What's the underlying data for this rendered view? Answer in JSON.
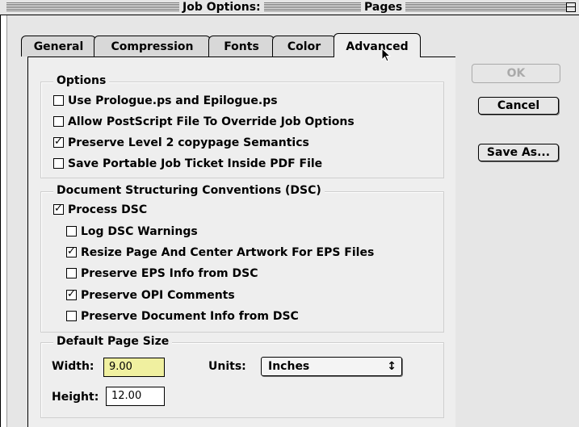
{
  "window": {
    "title_left": "Job Options:",
    "title_right": "Pages"
  },
  "tabs": [
    {
      "label": "General",
      "active": false
    },
    {
      "label": "Compression",
      "active": false
    },
    {
      "label": "Fonts",
      "active": false
    },
    {
      "label": "Color",
      "active": false
    },
    {
      "label": "Advanced",
      "active": true
    }
  ],
  "buttons": {
    "ok": "OK",
    "cancel": "Cancel",
    "save_as": "Save As..."
  },
  "options": {
    "legend": "Options",
    "items": [
      {
        "label": "Use Prologue.ps and Epilogue.ps",
        "checked": false
      },
      {
        "label": "Allow PostScript File To Override Job Options",
        "checked": false
      },
      {
        "label": "Preserve Level 2 copypage Semantics",
        "checked": true
      },
      {
        "label": "Save Portable Job Ticket Inside PDF File",
        "checked": false
      }
    ]
  },
  "dsc": {
    "legend": "Document Structuring Conventions (DSC)",
    "process": {
      "label": "Process DSC",
      "checked": true
    },
    "items": [
      {
        "label": "Log DSC Warnings",
        "checked": false
      },
      {
        "label": "Resize Page And Center Artwork For EPS Files",
        "checked": true
      },
      {
        "label": "Preserve EPS Info from DSC",
        "checked": false
      },
      {
        "label": "Preserve OPI Comments",
        "checked": true
      },
      {
        "label": "Preserve Document Info from DSC",
        "checked": false
      }
    ]
  },
  "page_size": {
    "legend": "Default Page Size",
    "width_label": "Width:",
    "width_value": "9.00",
    "units_label": "Units:",
    "units_value": "Inches",
    "height_label": "Height:",
    "height_value": "12.00"
  }
}
